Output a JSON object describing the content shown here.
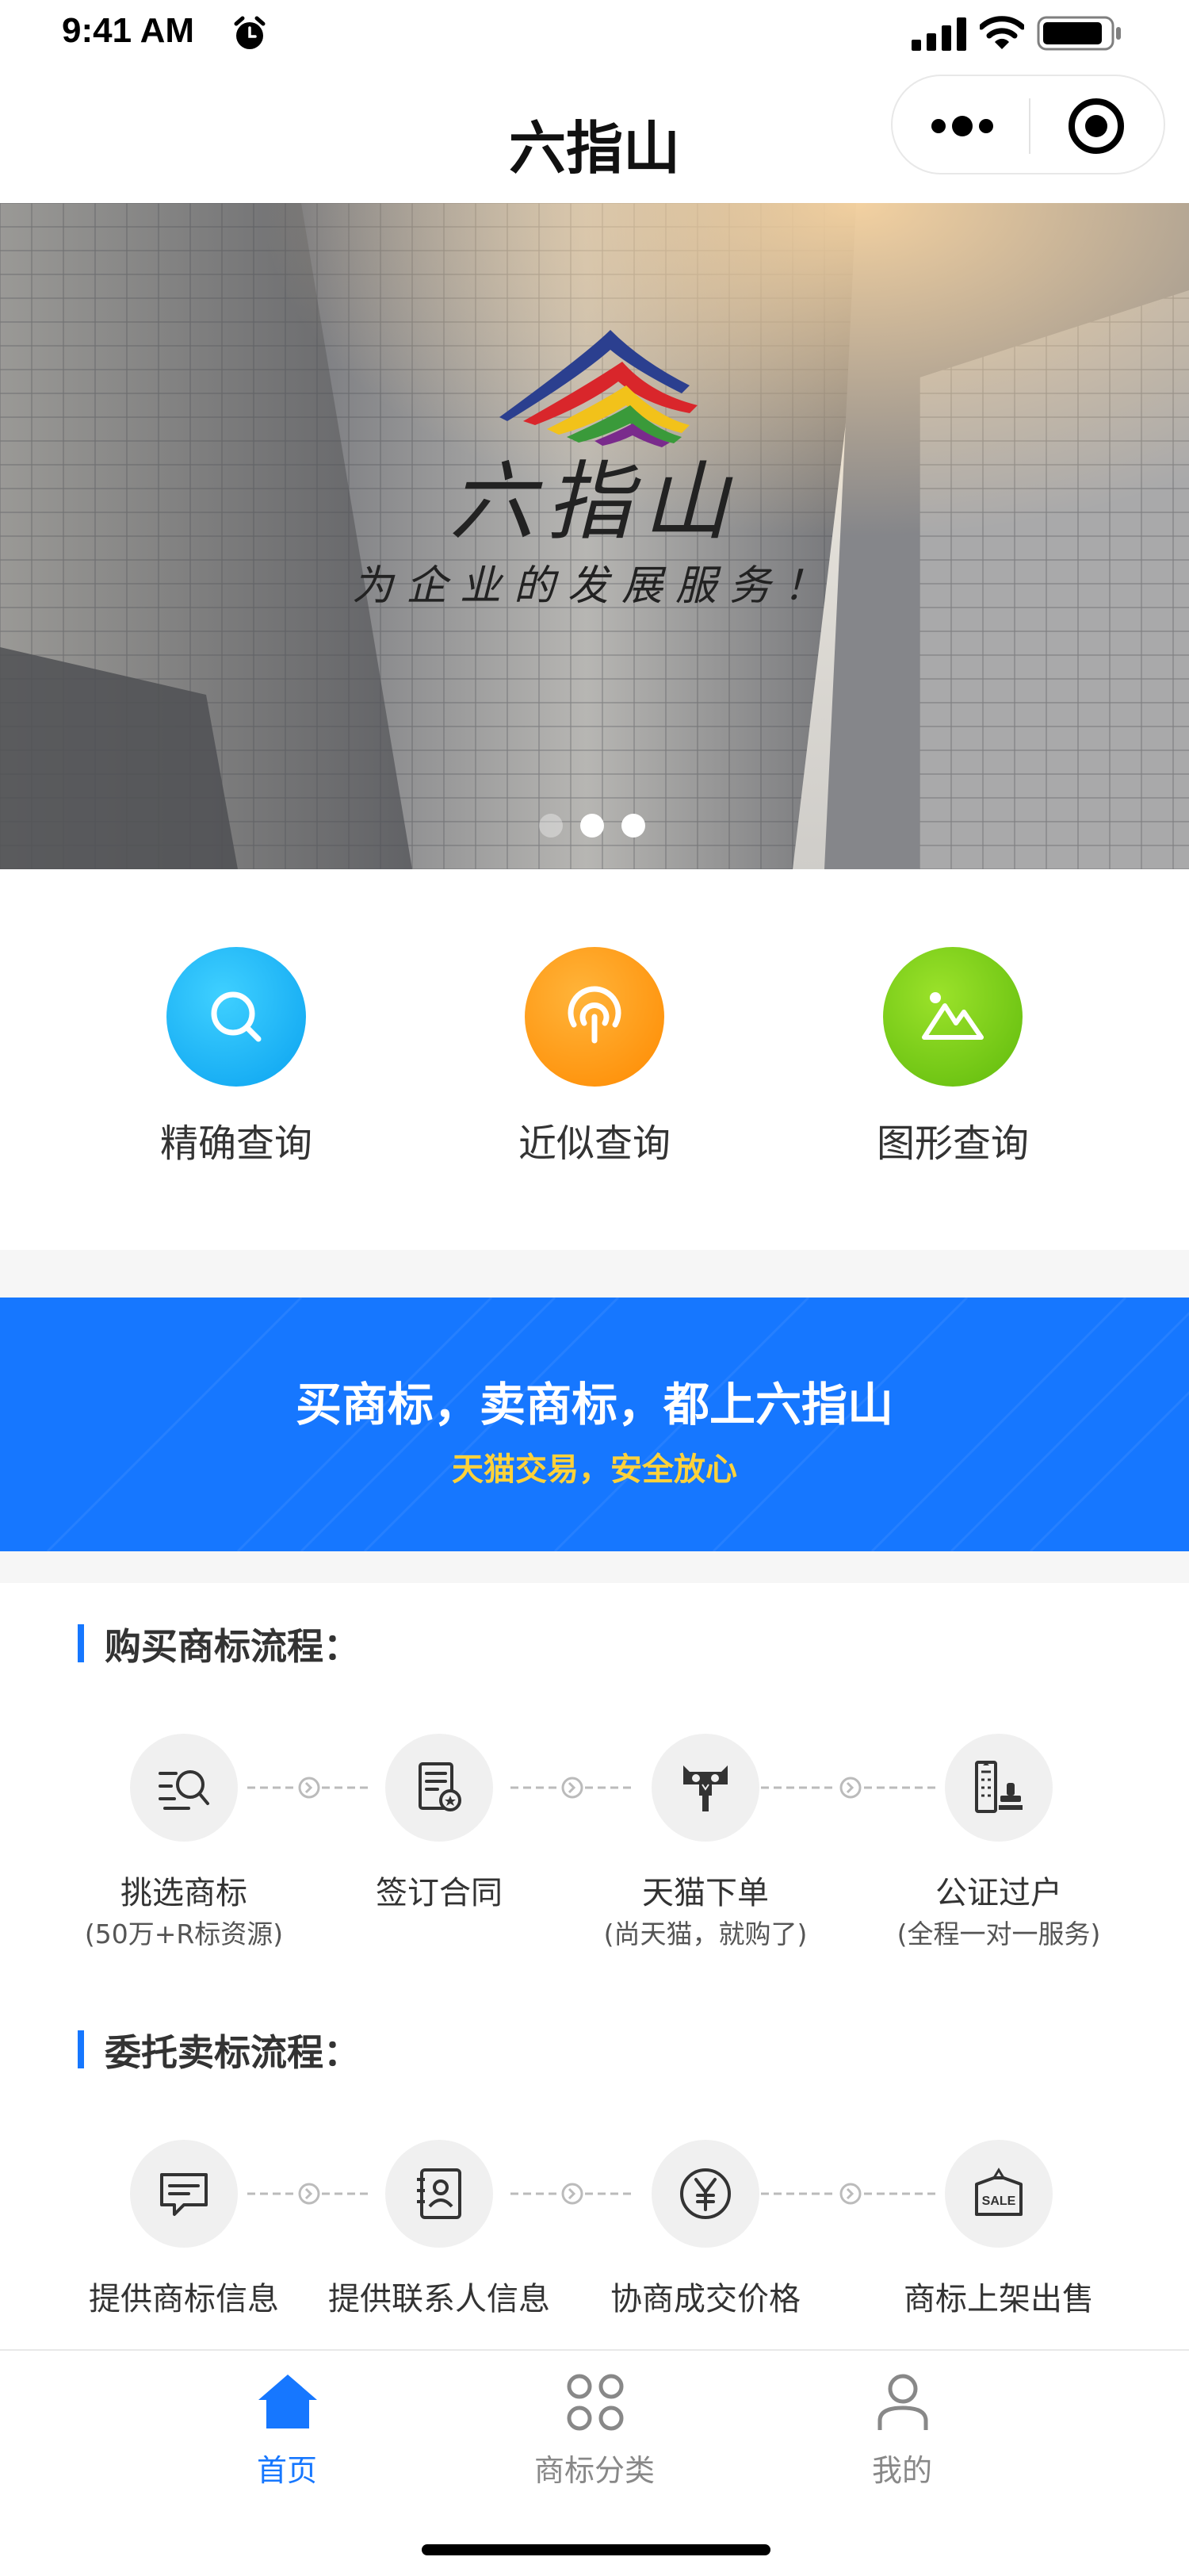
{
  "status_bar": {
    "time": "9:41 AM"
  },
  "nav": {
    "title": "六指山"
  },
  "banner": {
    "logo_text": "六指山",
    "slogan": "为企业的发展服务！",
    "slide_count": 3,
    "active_slide": 1
  },
  "quick_search": [
    {
      "label": "精确查询",
      "icon": "search-icon",
      "color": "#19b3f5"
    },
    {
      "label": "近似查询",
      "icon": "signal-broadcast-icon",
      "color": "#ff9a0a"
    },
    {
      "label": "图形查询",
      "icon": "image-mountain-icon",
      "color": "#7acc10"
    }
  ],
  "promo": {
    "title": "买商标，卖商标，都上六指山",
    "subtitle": "天猫交易，安全放心"
  },
  "buy_process": {
    "heading": "购买商标流程：",
    "steps": [
      {
        "label": "挑选商标",
        "note": "(50万+R标资源)",
        "icon": "search-list-icon"
      },
      {
        "label": "签订合同",
        "note": "",
        "icon": "contract-icon"
      },
      {
        "label": "天猫下单",
        "note": "(尚天猫，就购了)",
        "icon": "tmall-icon"
      },
      {
        "label": "公证过户",
        "note": "(全程一对一服务)",
        "icon": "notary-stamp-icon"
      }
    ]
  },
  "sell_process": {
    "heading": "委托卖标流程：",
    "steps": [
      {
        "label": "提供商标信息",
        "icon": "message-icon"
      },
      {
        "label": "提供联系人信息",
        "icon": "contact-book-icon"
      },
      {
        "label": "协商成交价格",
        "icon": "yen-icon"
      },
      {
        "label": "商标上架出售",
        "icon": "sale-tag-icon"
      }
    ]
  },
  "tab_bar": {
    "active_color": "#1677ff",
    "inactive_color": "#888888",
    "tabs": [
      {
        "label": "首页",
        "icon": "home-icon",
        "active": true
      },
      {
        "label": "商标分类",
        "icon": "category-icon",
        "active": false
      },
      {
        "label": "我的",
        "icon": "user-icon",
        "active": false
      }
    ]
  }
}
